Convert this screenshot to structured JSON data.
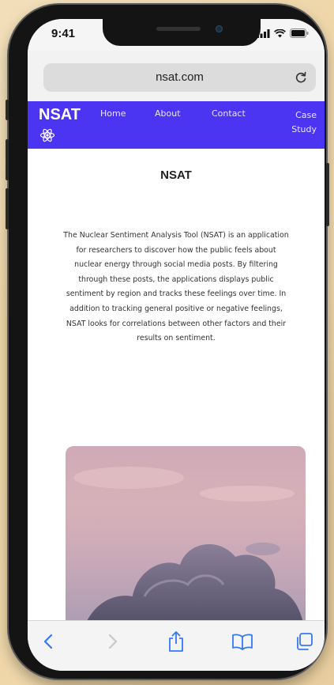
{
  "status_bar": {
    "time": "9:41"
  },
  "browser": {
    "url": "nsat.com",
    "reload_icon": "reload-icon"
  },
  "site": {
    "brand": "NSAT",
    "brand_icon": "atom-icon",
    "nav": {
      "home": "Home",
      "about": "About",
      "contact": "Contact",
      "case_line1": "Case",
      "case_line2": "Study"
    },
    "title": "NSAT",
    "description": "The Nuclear Sentiment Analysis Tool (NSAT) is an application for researchers to discover how the public feels about nuclear energy through social media posts. By filtering through these posts, the applications displays public sentiment by region and tracks these feelings over time. In addition to tracking general positive or negative feelings, NSAT looks for correlations between other factors and their results on sentiment."
  },
  "toolbar": {
    "items": [
      "back-icon",
      "forward-icon",
      "share-icon",
      "bookmarks-icon",
      "tabs-icon"
    ]
  },
  "colors": {
    "nav_bg": "#4b35f2",
    "page_bg": "#ffffff",
    "ios_blue": "#3478f6",
    "backdrop": "#efd7aa"
  }
}
